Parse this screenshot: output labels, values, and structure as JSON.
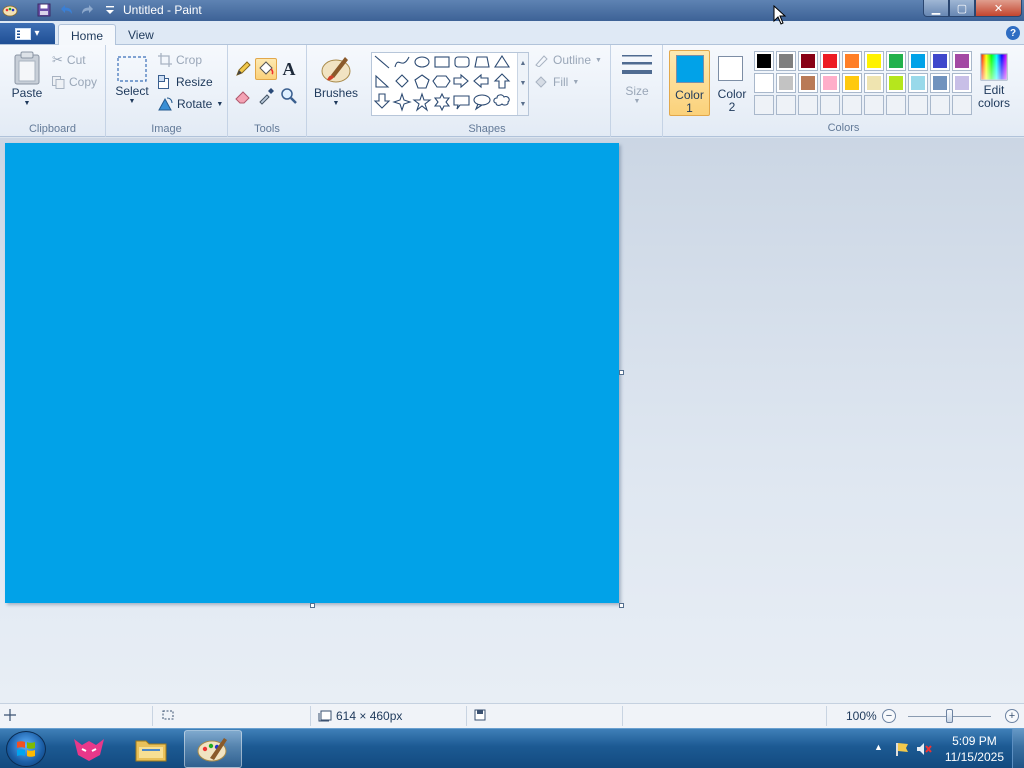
{
  "window": {
    "title": "Untitled - Paint",
    "controls": {
      "minimize": "▁",
      "maximize": "▢",
      "close": "✕"
    }
  },
  "tabs": [
    {
      "label": "Home",
      "active": true
    },
    {
      "label": "View",
      "active": false
    }
  ],
  "help": "?",
  "ribbon": {
    "clipboard": {
      "group_label": "Clipboard",
      "paste": "Paste",
      "cut": "Cut",
      "copy": "Copy"
    },
    "image": {
      "group_label": "Image",
      "select": "Select",
      "crop": "Crop",
      "resize": "Resize",
      "rotate": "Rotate"
    },
    "tools": {
      "group_label": "Tools",
      "selected_tool": "fill"
    },
    "brushes": {
      "label": "Brushes"
    },
    "shapes": {
      "group_label": "Shapes",
      "outline": "Outline",
      "fill": "Fill"
    },
    "size": {
      "label": "Size"
    },
    "colors": {
      "group_label": "Colors",
      "color1_label_line1": "Color",
      "color1_label_line2": "1",
      "color2_label_line1": "Color",
      "color2_label_line2": "2",
      "edit_line1": "Edit",
      "edit_line2": "colors",
      "color1": "#01a2e8",
      "color2": "#ffffff",
      "palette_row1": [
        "#000000",
        "#7f7f7f",
        "#880015",
        "#ed1c24",
        "#ff7f27",
        "#fff200",
        "#22b14c",
        "#00a2e8",
        "#3f48cc",
        "#a349a4"
      ],
      "palette_row2": [
        "#ffffff",
        "#c3c3c3",
        "#b97a57",
        "#ffaec9",
        "#ffc90e",
        "#efe4b0",
        "#b5e61d",
        "#99d9ea",
        "#7092be",
        "#c8bfe7"
      ]
    }
  },
  "canvas": {
    "color": "#01a2e8"
  },
  "statusbar": {
    "dimensions": "614 × 460px",
    "zoom": "100%",
    "zoom_fraction": 0.5
  },
  "taskbar": {
    "time": "5:09 PM",
    "date": "11/15/2025"
  }
}
